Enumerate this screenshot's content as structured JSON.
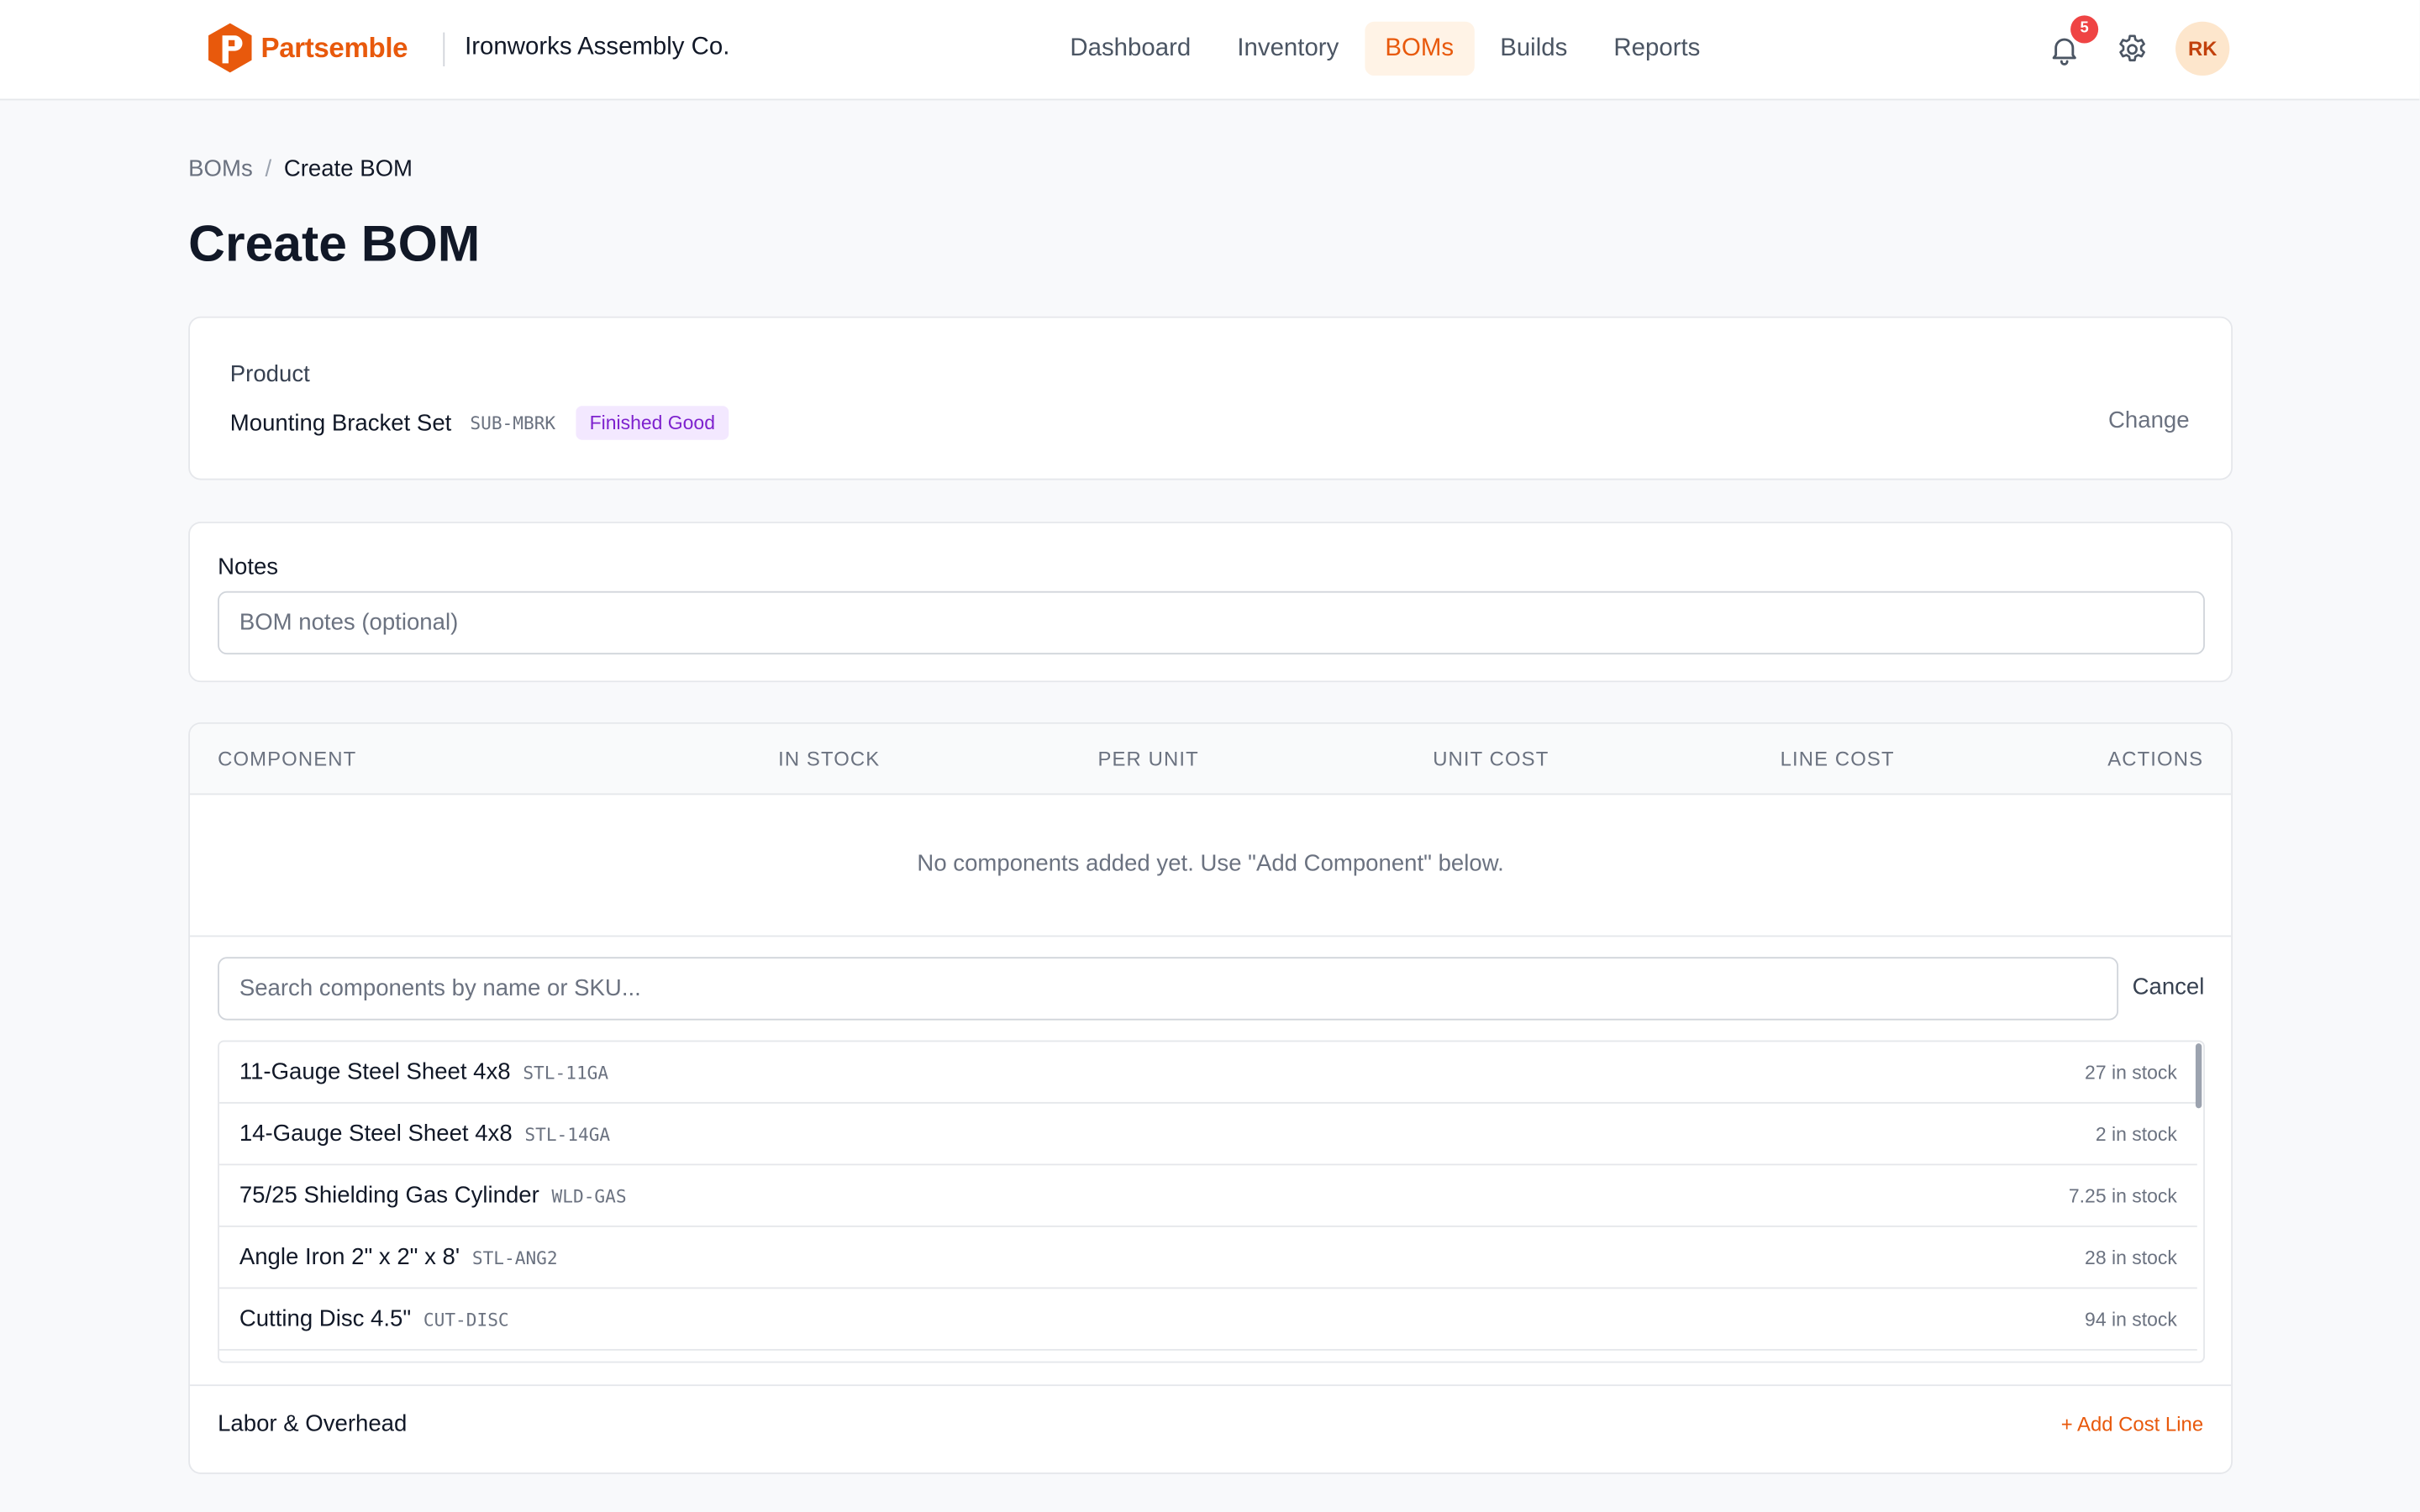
{
  "header": {
    "brand_name": "Partsemble",
    "company": "Ironworks Assembly Co.",
    "nav": [
      {
        "label": "Dashboard",
        "active": false
      },
      {
        "label": "Inventory",
        "active": false
      },
      {
        "label": "BOMs",
        "active": true
      },
      {
        "label": "Builds",
        "active": false
      },
      {
        "label": "Reports",
        "active": false
      }
    ],
    "notification_count": "5",
    "avatar_initials": "RK",
    "accent_color": "#e8590c"
  },
  "breadcrumb": {
    "parent": "BOMs",
    "separator": "/",
    "current": "Create BOM"
  },
  "page_title": "Create BOM",
  "product": {
    "label": "Product",
    "name": "Mounting Bracket Set",
    "sku": "SUB-MBRK",
    "type_badge": "Finished Good",
    "change_label": "Change"
  },
  "notes": {
    "label": "Notes",
    "placeholder": "BOM notes (optional)",
    "value": ""
  },
  "components_table": {
    "columns": [
      "COMPONENT",
      "IN STOCK",
      "PER UNIT",
      "UNIT COST",
      "LINE COST",
      "ACTIONS"
    ],
    "empty_message": "No components added yet. Use \"Add Component\" below."
  },
  "component_search": {
    "placeholder": "Search components by name or SKU...",
    "value": "",
    "cancel_label": "Cancel",
    "results": [
      {
        "name": "11-Gauge Steel Sheet 4x8",
        "sku": "STL-11GA",
        "stock": "27 in stock"
      },
      {
        "name": "14-Gauge Steel Sheet 4x8",
        "sku": "STL-14GA",
        "stock": "2 in stock"
      },
      {
        "name": "75/25 Shielding Gas Cylinder",
        "sku": "WLD-GAS",
        "stock": "7.25 in stock"
      },
      {
        "name": "Angle Iron 2\" x 2\" x 8'",
        "sku": "STL-ANG2",
        "stock": "28 in stock"
      },
      {
        "name": "Cutting Disc 4.5\"",
        "sku": "CUT-DISC",
        "stock": "94 in stock"
      }
    ]
  },
  "labor": {
    "label": "Labor & Overhead",
    "add_label": "+ Add Cost Line"
  }
}
